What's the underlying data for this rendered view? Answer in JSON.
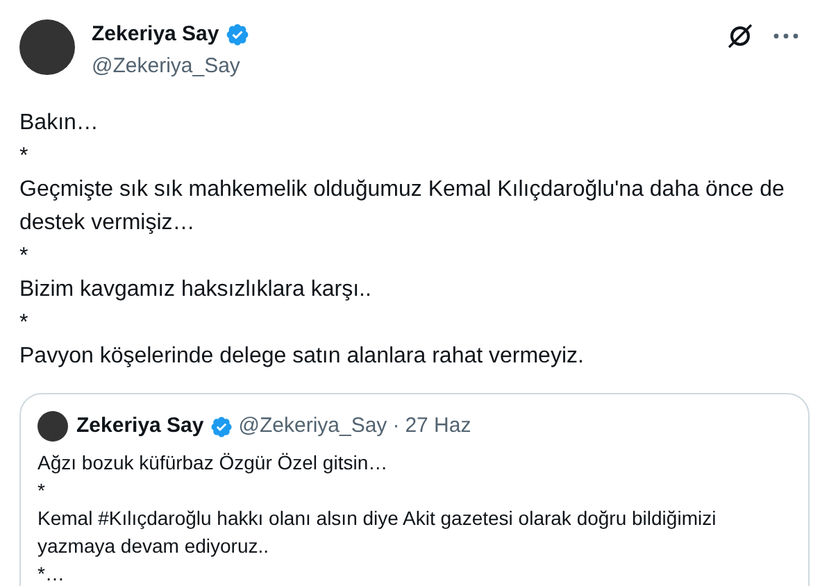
{
  "author": {
    "name": "Zekeriya Say",
    "handle": "@Zekeriya_Say",
    "verified": true
  },
  "body": [
    "Bakın…",
    "*",
    "Geçmişte sık sık mahkemelik olduğumuz Kemal Kılıçdaroğlu'na daha önce de destek vermişiz…",
    "*",
    "Bizim kavgamız haksızlıklara karşı..",
    "*",
    "Pavyon köşelerinde delege satın alanlara rahat vermeyiz."
  ],
  "quote": {
    "name": "Zekeriya Say",
    "verified": true,
    "handle": "@Zekeriya_Say",
    "separator": "·",
    "date": "27 Haz",
    "body": [
      "Ağzı bozuk küfürbaz Özgür Özel gitsin…",
      "*",
      "Kemal #Kılıçdaroğlu hakkı olanı alsın diye Akit gazetesi olarak doğru bildiğimizi yazmaya devam ediyoruz..",
      "*…"
    ]
  }
}
